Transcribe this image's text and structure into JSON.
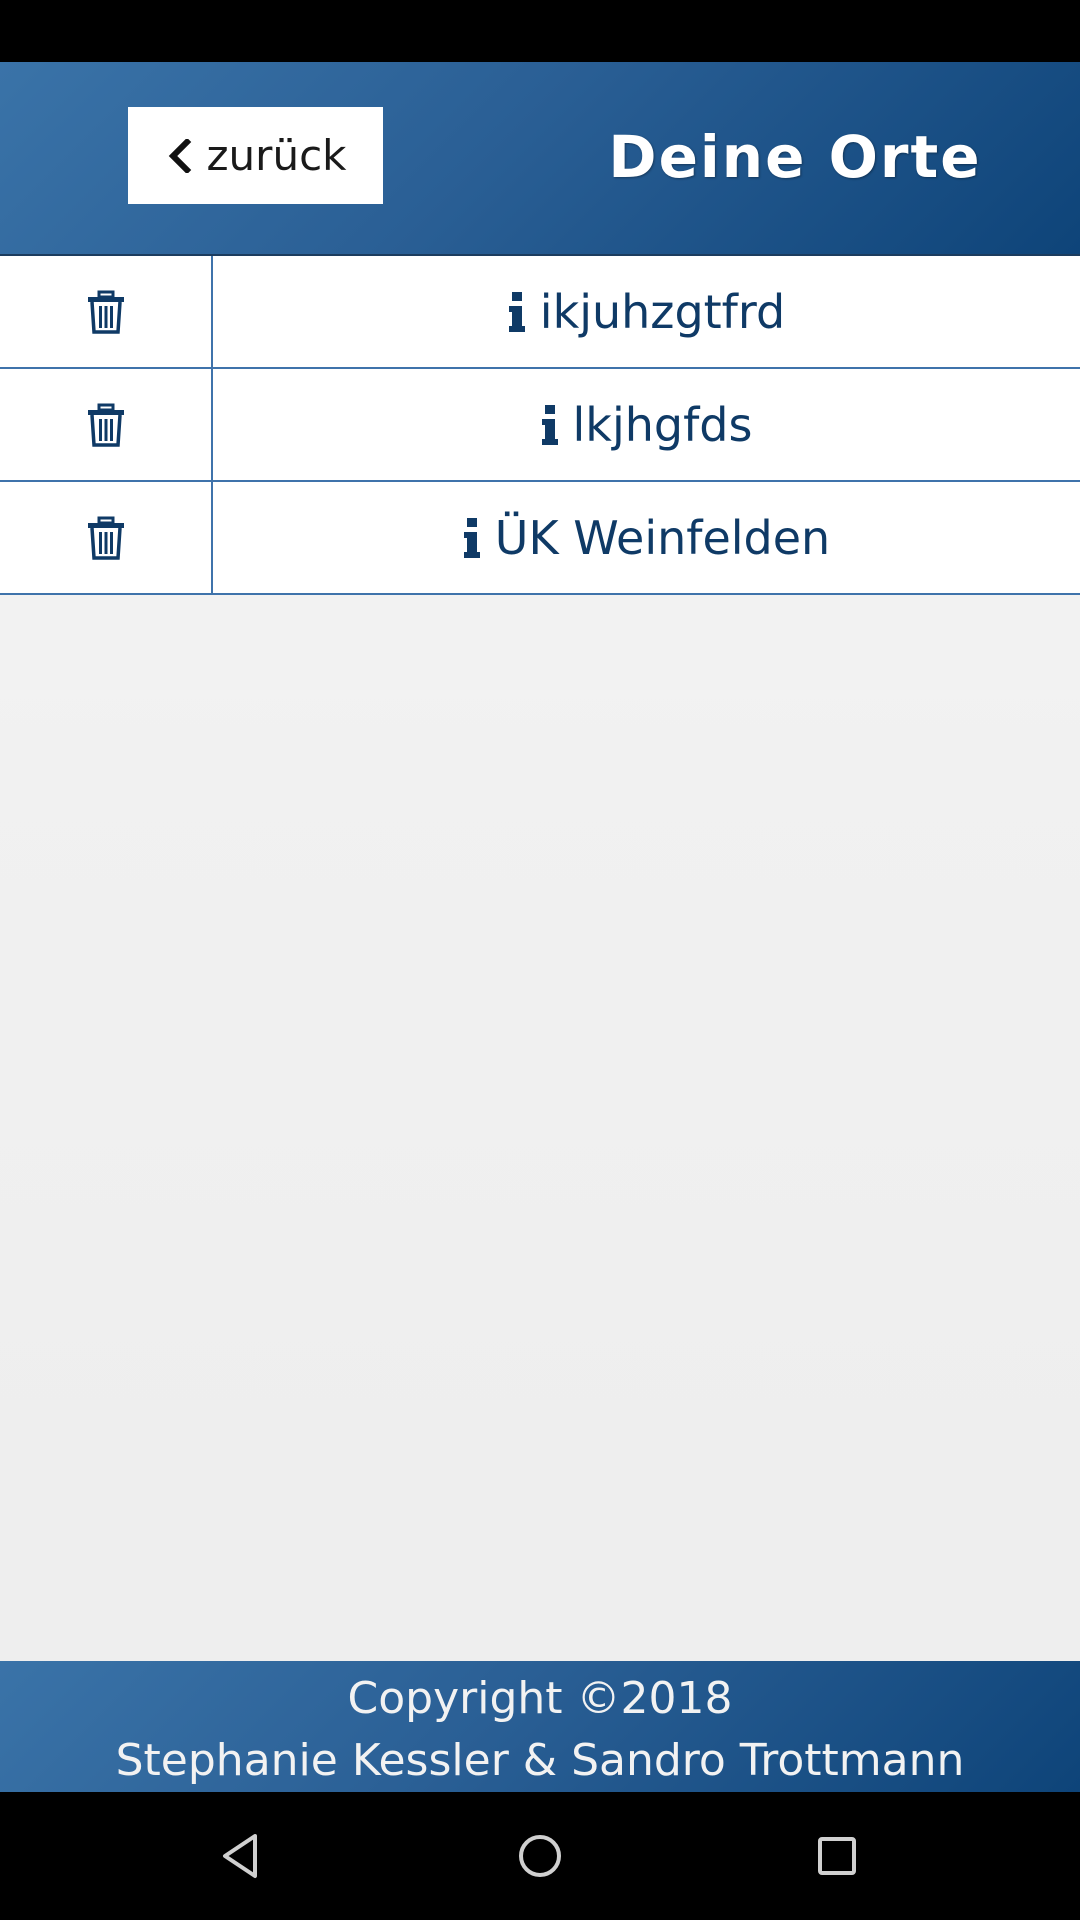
{
  "header": {
    "back_label": "zurück",
    "title": "Deine Orte"
  },
  "places": [
    {
      "name": "ikjuhzgtfrd"
    },
    {
      "name": "lkjhgfds"
    },
    {
      "name": "ÜK Weinfelden"
    }
  ],
  "footer": {
    "line1": "Copyright ©2018",
    "line2": "Stephanie Kessler & Sandro Trottmann"
  },
  "icons": {
    "back": "chevron-left-icon",
    "delete": "trash-icon",
    "info": "info-icon",
    "nav_back": "triangle-back-icon",
    "nav_home": "circle-home-icon",
    "nav_recents": "square-recents-icon"
  },
  "colors": {
    "header_start": "#3a73a8",
    "header_end": "#0e4479",
    "row_text": "#0f3a66",
    "row_border": "#3f73ab",
    "background": "#f1f1f1"
  }
}
